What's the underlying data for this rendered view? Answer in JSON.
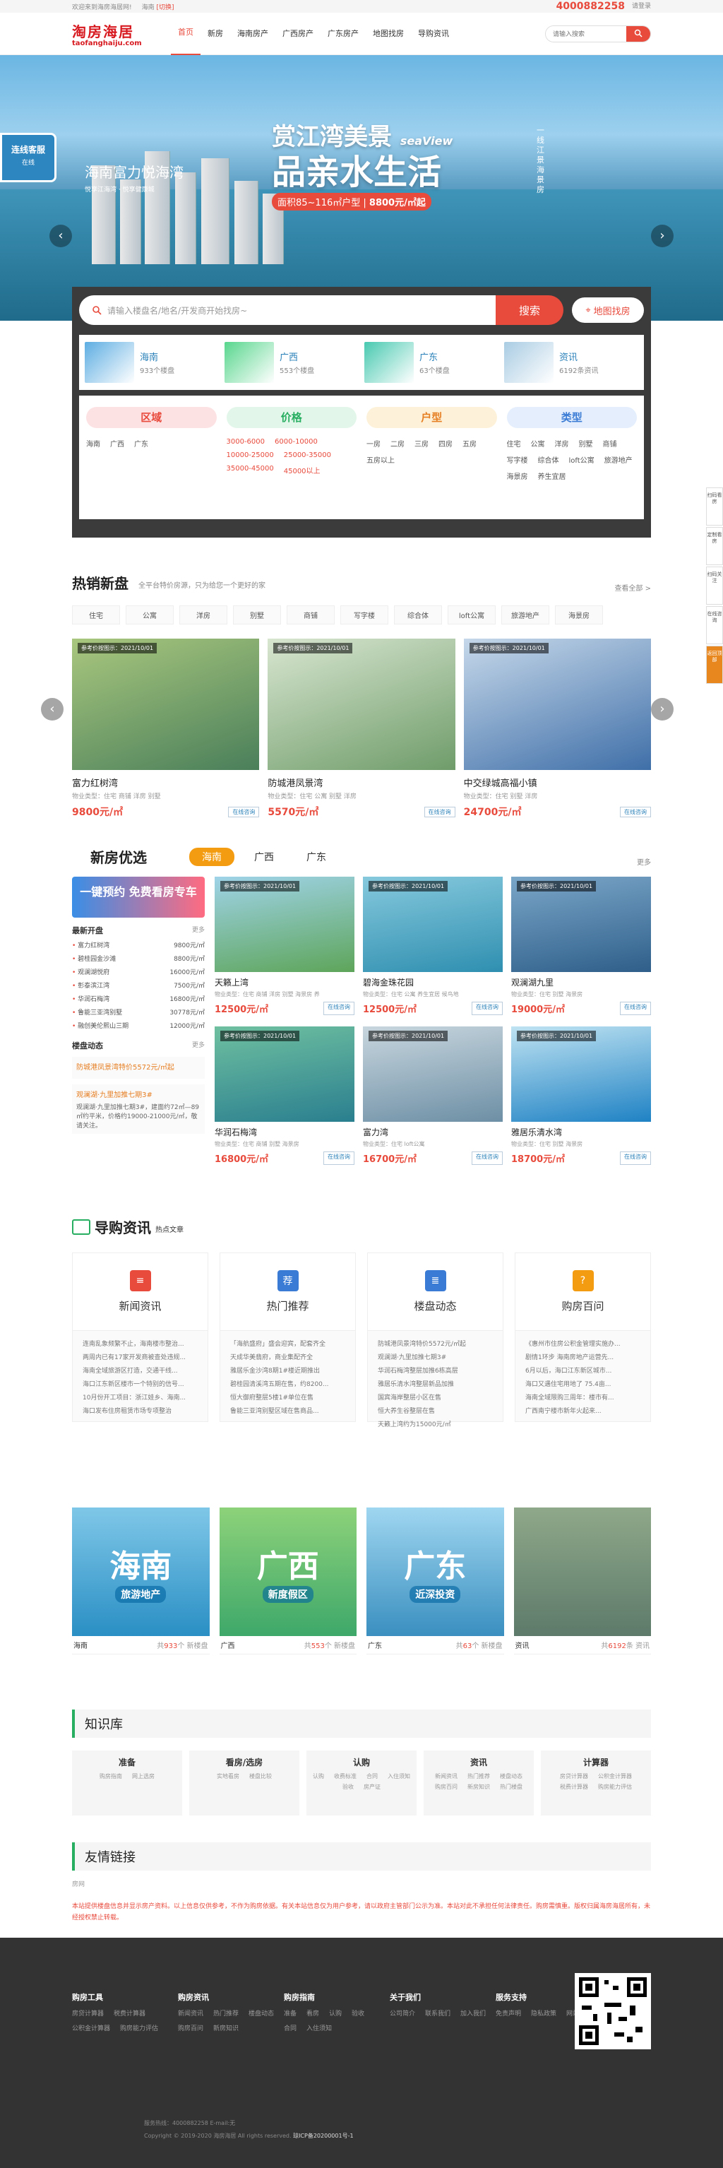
{
  "topbar": {
    "welcome": "欢迎来到海房海居网!",
    "location": "海南",
    "switch": "[切换]",
    "tel": "4000882258",
    "login": "请登录",
    "slogan": "海房海居"
  },
  "logo": {
    "cn": "淘房海居",
    "en": "taofanghaiju.com"
  },
  "nav": [
    "首页",
    "新房",
    "海南房产",
    "广西房产",
    "广东房产",
    "地图找房",
    "导购资讯"
  ],
  "header_search": {
    "placeholder": "请输入搜索"
  },
  "banner": {
    "brand": "海南富力悦海湾",
    "brand_sub": "悦享江海湾 · 悦享健康城",
    "title1": "赏江湾美景",
    "title1_en": "seaView",
    "title2": "品亲水生活",
    "tag_area": "面积85~116㎡户型",
    "tag_price": "8800元/㎡起",
    "vertical": "一线 江景 海 景 房",
    "kefu": "连线客服",
    "kefu_sub": "在线"
  },
  "search": {
    "placeholder": "请输入楼盘名/地名/开发商开始找房~",
    "button": "搜索",
    "map_button": "地图找房"
  },
  "regions": [
    {
      "name": "海南",
      "count": "933个楼盘",
      "color": "#5dade2"
    },
    {
      "name": "广西",
      "count": "553个楼盘",
      "color": "#58d68d"
    },
    {
      "name": "广东",
      "count": "63个楼盘",
      "color": "#48c9b0"
    },
    {
      "name": "资讯",
      "count": "6192条资讯",
      "color": "#a9cce3"
    }
  ],
  "filters": [
    {
      "title": "区域",
      "bg": "#fde2e4",
      "color": "#e84a3c",
      "items": [
        "海南",
        "广西",
        "广东"
      ]
    },
    {
      "title": "价格",
      "bg": "#e2f6e9",
      "color": "#27ae60",
      "items": [
        "3000-6000",
        "6000-10000",
        "10000-25000",
        "25000-35000",
        "35000-45000",
        "45000以上"
      ]
    },
    {
      "title": "户型",
      "bg": "#fdf2d9",
      "color": "#e67e22",
      "items": [
        "一房",
        "二房",
        "三房",
        "四房",
        "五房",
        "五房以上"
      ]
    },
    {
      "title": "类型",
      "bg": "#e4eefc",
      "color": "#3a7bd5",
      "items": [
        "住宅",
        "公寓",
        "洋房",
        "别墅",
        "商铺",
        "写字楼",
        "综合体",
        "loft公寓",
        "旅游地产",
        "海景房",
        "养生宜居"
      ]
    }
  ],
  "hot": {
    "title": "热销新盘",
    "subtitle": "全平台特价房源，只为给您一个更好的家",
    "more": "查看全部 >",
    "tags": [
      "住宅",
      "公寓",
      "洋房",
      "别墅",
      "商铺",
      "写字楼",
      "综合体",
      "loft公寓",
      "旅游地产",
      "海景房"
    ],
    "cards": [
      {
        "badge": "参考价按图示：2021/10/01",
        "name": "富力红树湾",
        "type": "物业类型：住宅 商铺 洋房 别墅",
        "price": "9800元/㎡",
        "consult": "在线咨询",
        "c1": "#4a7f5a",
        "c2": "#a9c77e"
      },
      {
        "badge": "参考价按图示：2021/10/01",
        "name": "防城港凤景湾",
        "type": "物业类型：住宅 公寓 别墅 洋房",
        "price": "5570元/㎡",
        "consult": "在线咨询",
        "c1": "#6f9c6a",
        "c2": "#d8e6d0"
      },
      {
        "badge": "参考价按图示：2021/10/01",
        "name": "中交绿城高福小镇",
        "type": "物业类型：住宅 别墅 洋房",
        "price": "24700元/㎡",
        "consult": "在线咨询",
        "c1": "#3f6fa8",
        "c2": "#c6d8ea"
      }
    ]
  },
  "xinfang": {
    "title": "新房优选",
    "tabs": [
      "海南",
      "广西",
      "广东"
    ],
    "more": "更多",
    "promo": "一键预约 免费看房专车",
    "latest_title": "最新开盘",
    "latest_more": "更多",
    "latest": [
      [
        "富力红树湾",
        "9800元/㎡"
      ],
      [
        "碧桂园金沙滩",
        "8800元/㎡"
      ],
      [
        "观澜湖悦府",
        "16000元/㎡"
      ],
      [
        "彰泰滨江湾",
        "7500元/㎡"
      ],
      [
        "华润石梅湾",
        "16800元/㎡"
      ],
      [
        "鲁能三亚湾别墅",
        "30778元/㎡"
      ],
      [
        "融创美伦熙山三期",
        "12000元/㎡"
      ]
    ],
    "news_title": "楼盘动态",
    "news_more": "更多",
    "news": [
      {
        "t": "防城港凤景湾特价5572元/㎡起",
        "d": ""
      },
      {
        "t": "观澜湖·九里加推七期3#",
        "d": "观澜湖·九里加推七期3#，建面约72㎡—89㎡约平米，价格约19000-21000元/㎡，敬请关注。"
      }
    ],
    "cards": [
      {
        "name": "天籁上湾",
        "type": "物业类型：住宅 商铺 洋房 别墅 海景房 养",
        "price": "12500元/㎡",
        "c1": "#5ea55a",
        "c2": "#9fd3e8"
      },
      {
        "name": "碧海金珠花园",
        "type": "物业类型：住宅 公寓 养生宜居 候鸟地",
        "price": "12500元/㎡",
        "c1": "#2f8fb0",
        "c2": "#86c9dd"
      },
      {
        "name": "观澜湖九里",
        "type": "物业类型：住宅 别墅 海景房",
        "price": "19000元/㎡",
        "c1": "#2f5f8a",
        "c2": "#7aa6c8"
      },
      {
        "name": "华润石梅湾",
        "type": "物业类型：住宅 商铺 别墅 海景房",
        "price": "16800元/㎡",
        "c1": "#2a7f8f",
        "c2": "#6fc0a0"
      },
      {
        "name": "富力湾",
        "type": "物业类型：住宅 loft公寓",
        "price": "16700元/㎡",
        "c1": "#6d8fa5",
        "c2": "#c8d6de"
      },
      {
        "name": "雅居乐清水湾",
        "type": "物业类型：住宅 别墅 海景房",
        "price": "18700元/㎡",
        "c1": "#1f82c4",
        "c2": "#bfe3f2"
      }
    ],
    "card_badge": "参考价按图示：2021/10/01",
    "consult": "在线咨询"
  },
  "guide": {
    "title": "导购资讯",
    "subtitle": "热点文章",
    "cards": [
      {
        "title": "新闻资讯",
        "icon": "≡",
        "color": "#e84a3c",
        "lines": [
          "连南乱象频繁不止，海南楼市整治...",
          "两周内已有17家开发商被查处违规...",
          "海南全域旅游区打造，交通干线...",
          "海口江东新区楼市一个特别的信号...",
          "10月份开工项目：浙江娃乡、海南...",
          "海口发布住房租赁市场专项整治"
        ]
      },
      {
        "title": "热门推荐",
        "icon": "荐",
        "color": "#3a7bd5",
        "lines": [
          "「海航盛府」盛会迎宾，配套齐全",
          "天成华美翡府，商业集配齐全",
          "雅居乐金沙湾8期1#楼近期推出",
          "碧桂园清溪湾五期在售，约8200...",
          "恒大御府整层5楼1#单位在售",
          "鲁能三亚湾别墅区域在售商品..."
        ]
      },
      {
        "title": "楼盘动态",
        "icon": "≣",
        "color": "#3a7bd5",
        "lines": [
          "防城港凤景湾特价5572元/㎡起",
          "观澜湖·九里加推七期3#",
          "华润石梅湾整层加推6栋高层",
          "雅居乐清水湾整层新品加推",
          "国宾海岸整层小区在售",
          "恒大养生谷整层在售",
          "天籁上湾约为15000元/㎡"
        ]
      },
      {
        "title": "购房百问",
        "icon": "?",
        "color": "#f39c12",
        "lines": [
          "《惠州市住房公积金管理实施办...",
          "剧情1环步 海南房地产运营先...",
          "6月以后，海口江东新区城市...",
          "海口又遇住宅用地了 75.4亩...",
          "海南全域限购三周年：楼市有...",
          "广西南宁楼市新年火起来..."
        ]
      }
    ]
  },
  "region_cards": [
    {
      "name": "海南",
      "label": "海南",
      "sub": "旅游地产",
      "count_pre": "共",
      "count": "933",
      "count_suf": "个 新楼盘",
      "c1": "#7fc7e8",
      "c2": "#2a8fc4"
    },
    {
      "name": "广西",
      "label": "广西",
      "sub": "新度假区",
      "count_pre": "共",
      "count": "553",
      "count_suf": "个 新楼盘",
      "c1": "#8dd27a",
      "c2": "#3ea86a"
    },
    {
      "name": "广东",
      "label": "广东",
      "sub": "近深投资",
      "count_pre": "共",
      "count": "63",
      "count_suf": "个 新楼盘",
      "c1": "#9fd6f0",
      "c2": "#3a8fc0"
    },
    {
      "name": "资讯",
      "label": "",
      "sub": "",
      "count_pre": "共",
      "count": "6192",
      "count_suf": "条 资讯",
      "c1": "#8fa88a",
      "c2": "#5d7a6a"
    }
  ],
  "knowledge": {
    "title": "知识库",
    "cols": [
      {
        "h": "准备",
        "items": [
          "购房指南",
          "网上选房"
        ]
      },
      {
        "h": "看房/选房",
        "items": [
          "实地看房",
          "楼盘比较"
        ]
      },
      {
        "h": "认购",
        "items": [
          "认购",
          "收费标准",
          "合同",
          "入住须知",
          "验收",
          "房产证"
        ]
      },
      {
        "h": "资讯",
        "items": [
          "新闻资讯",
          "热门推荐",
          "楼盘动态",
          "购房百问",
          "新房知识",
          "热门楼盘"
        ]
      },
      {
        "h": "计算器",
        "items": [
          "房贷计算器",
          "公积金计算器",
          "税费计算器",
          "购房能力评估"
        ]
      }
    ]
  },
  "links": {
    "title": "友情链接",
    "items": [
      "房网"
    ]
  },
  "disclaimer": "本站提供楼盘信息并显示房产资料。以上信息仅供参考，不作为购房依据。有关本站信息仅为用户参考，请以政府主管部门公示为准。本站对此不承担任何法律责任。购房需慎重。版权归属海房海居所有，未经授权禁止转载。",
  "footer": {
    "cols": [
      {
        "h": "购房工具",
        "items": [
          "房贷计算器",
          "税费计算器",
          "公积金计算器",
          "购房能力评估"
        ]
      },
      {
        "h": "购房资讯",
        "items": [
          "新闻资讯",
          "热门推荐",
          "楼盘动态",
          "购房百问",
          "新房知识"
        ]
      },
      {
        "h": "购房指南",
        "items": [
          "准备",
          "看房",
          "认购",
          "验收",
          "合同",
          "入住须知"
        ]
      },
      {
        "h": "关于我们",
        "items": [
          "公司简介",
          "联系我们",
          "加入我们"
        ]
      },
      {
        "h": "服务支持",
        "items": [
          "免责声明",
          "隐私政策",
          "网站地图"
        ]
      }
    ],
    "contact": "服务热线：4000882258  E-mail:无",
    "copyright": "Copyright © 2019-2020 海房海居 All rights reserved.",
    "icp": "琼ICP备20200001号-1"
  },
  "sidebar": [
    "扫码看房",
    "定制看房",
    "扫码关注",
    "在线咨询",
    "返回顶部"
  ]
}
